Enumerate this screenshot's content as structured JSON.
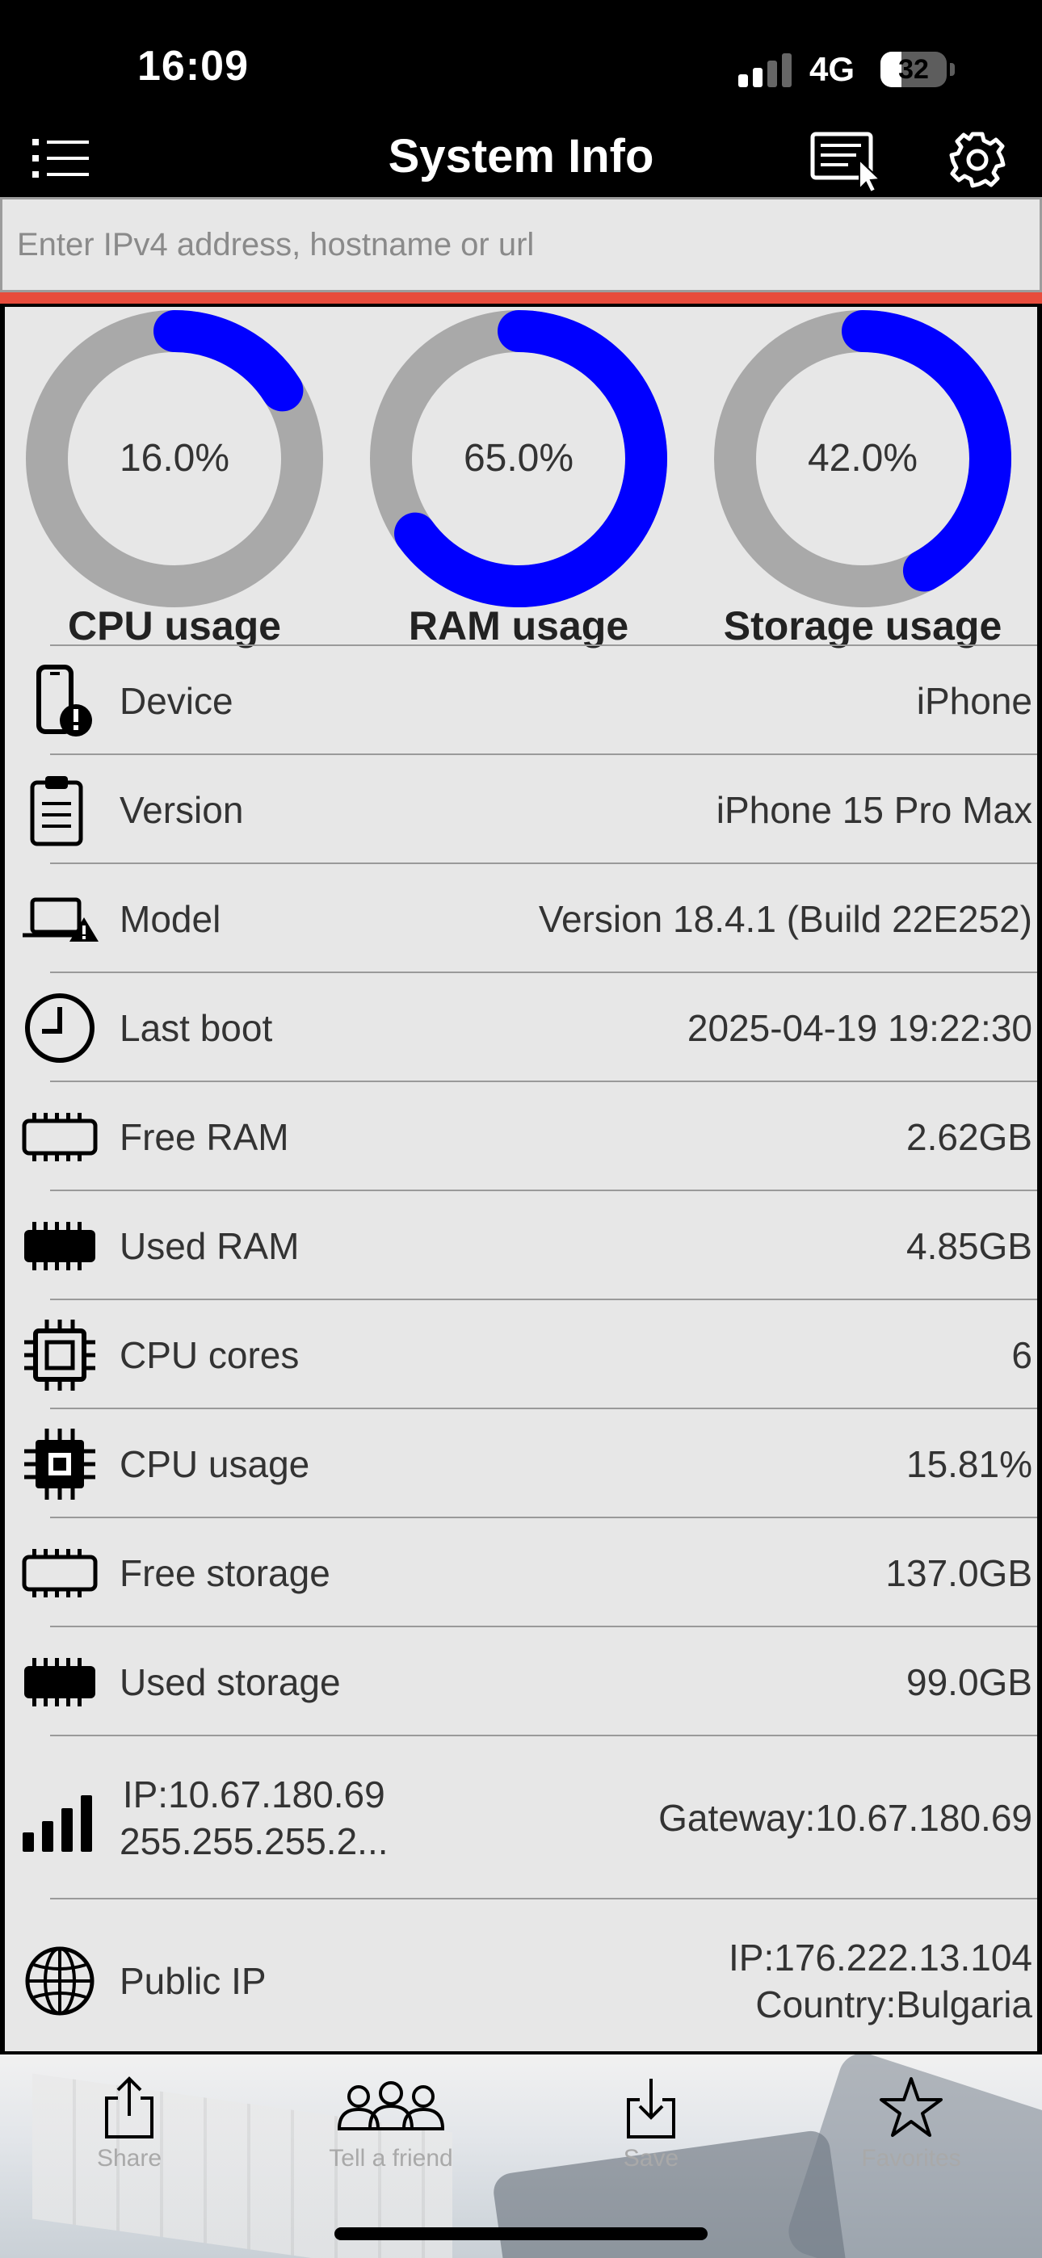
{
  "status_bar": {
    "time": "16:09",
    "network": "4G",
    "battery": "32",
    "battery_level": 0.32
  },
  "nav": {
    "title": "System Info",
    "icons": [
      "menu-list-icon",
      "log-cursor-icon",
      "gear-icon"
    ]
  },
  "search": {
    "placeholder": "Enter IPv4 address, hostname or url",
    "value": ""
  },
  "colors": {
    "accent": "#0000ff",
    "track": "#a9a9a9",
    "divider": "#e74c3c",
    "panel": "#e7e7e7"
  },
  "gauges": [
    {
      "value_text": "16.0%",
      "value": 16.0,
      "label": "CPU usage"
    },
    {
      "value_text": "65.0%",
      "value": 65.0,
      "label": "RAM usage"
    },
    {
      "value_text": "42.0%",
      "value": 42.0,
      "label": "Storage usage"
    }
  ],
  "rows": [
    {
      "icon": "phone-alert-icon",
      "label": "Device",
      "value": "iPhone"
    },
    {
      "icon": "clipboard-icon",
      "label": "Version",
      "value": "iPhone 15 Pro Max"
    },
    {
      "icon": "laptop-warning-icon",
      "label": "Model",
      "value": "Version 18.4.1 (Build 22E252)"
    },
    {
      "icon": "clock-icon",
      "label": "Last boot",
      "value": "2025-04-19 19:22:30"
    },
    {
      "icon": "ram-outline-icon",
      "label": "Free RAM",
      "value": "2.62GB"
    },
    {
      "icon": "ram-filled-icon",
      "label": "Used RAM",
      "value": "4.85GB"
    },
    {
      "icon": "cpu-outline-icon",
      "label": "CPU cores",
      "value": "6"
    },
    {
      "icon": "cpu-filled-icon",
      "label": "CPU usage",
      "value": "15.81%"
    },
    {
      "icon": "storage-outline-icon",
      "label": "Free storage",
      "value": "137.0GB"
    },
    {
      "icon": "storage-filled-icon",
      "label": "Used storage",
      "value": "99.0GB"
    }
  ],
  "network_row": {
    "icon": "signal-bars-icon",
    "label_line1": "IP:10.67.180.69",
    "label_line2": "255.255.255.2...",
    "value": "Gateway:10.67.180.69"
  },
  "public_row": {
    "icon": "globe-icon",
    "label": "Public IP",
    "value_line1": "IP:176.222.13.104",
    "value_line2": "Country:Bulgaria"
  },
  "toolbar": [
    {
      "icon": "share-icon",
      "label": "Share"
    },
    {
      "icon": "people-icon",
      "label": "Tell a friend"
    },
    {
      "icon": "save-download-icon",
      "label": "Save"
    },
    {
      "icon": "star-icon",
      "label": "Favorites"
    }
  ]
}
